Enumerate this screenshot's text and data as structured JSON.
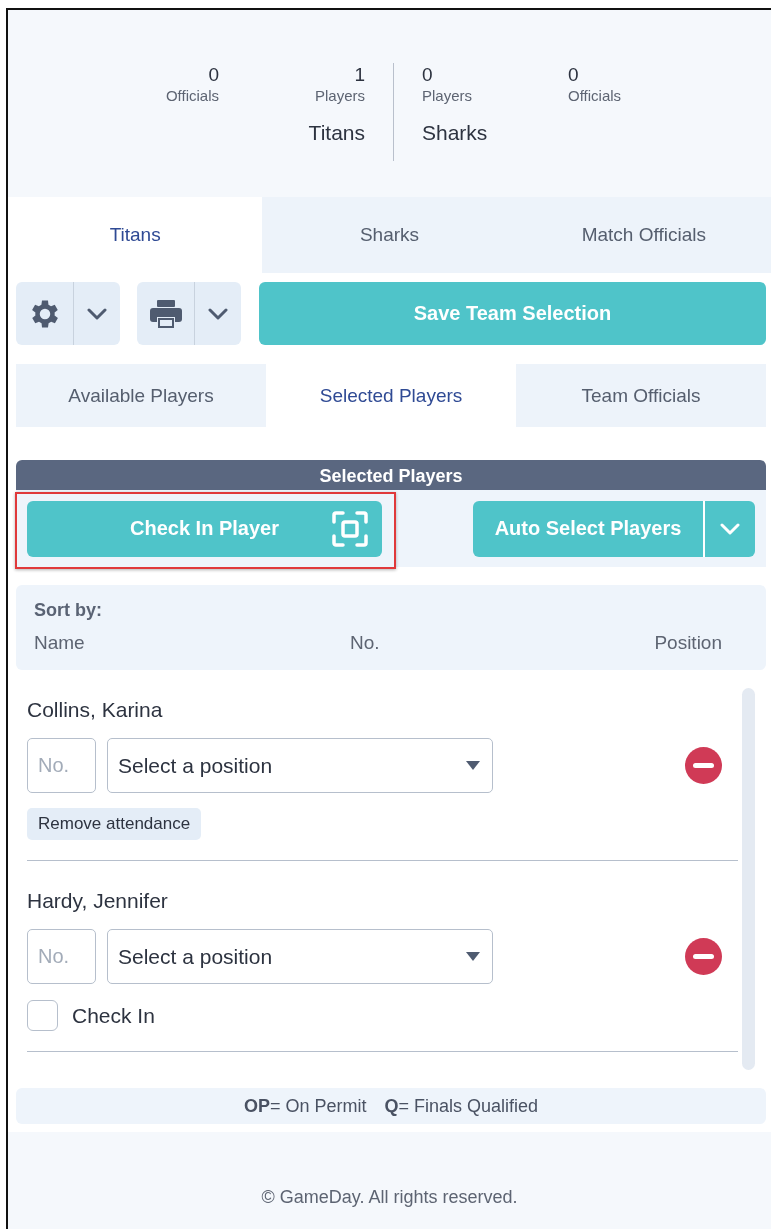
{
  "summary": {
    "home": {
      "team": "Titans",
      "stats": [
        {
          "value": "0",
          "label": "Officials"
        },
        {
          "value": "1",
          "label": "Players"
        }
      ]
    },
    "away": {
      "team": "Sharks",
      "stats": [
        {
          "value": "0",
          "label": "Players"
        },
        {
          "value": "0",
          "label": "Officials"
        }
      ]
    }
  },
  "team_tabs": [
    {
      "label": "Titans",
      "selected": true
    },
    {
      "label": "Sharks",
      "selected": false
    },
    {
      "label": "Match Officials",
      "selected": false
    }
  ],
  "toolbar": {
    "save_button": "Save Team Selection"
  },
  "section_tabs": [
    {
      "label": "Available Players",
      "selected": false
    },
    {
      "label": "Selected Players",
      "selected": true
    },
    {
      "label": "Team Officials",
      "selected": false
    }
  ],
  "panel": {
    "title": "Selected Players",
    "check_in_button": {
      "label": "Check In Player",
      "highlighted": true
    },
    "auto_select_button": "Auto Select Players"
  },
  "sort": {
    "title": "Sort by:",
    "columns": [
      "Name",
      "No.",
      "Position"
    ]
  },
  "players": [
    {
      "name": "Collins, Karina",
      "number": {
        "placeholder": "No."
      },
      "position": "Select a position",
      "attendance": {
        "kind": "button",
        "label": "Remove attendance"
      }
    },
    {
      "name": "Hardy, Jennifer",
      "number": {
        "placeholder": "No."
      },
      "position": "Select a position",
      "attendance": {
        "kind": "checkbox",
        "label": "Check In",
        "checked": false
      }
    }
  ],
  "legend": [
    "**OP**= On Permit",
    "**Q**= Finals Qualified"
  ],
  "footer": "© GameDay. All rights reserved."
}
